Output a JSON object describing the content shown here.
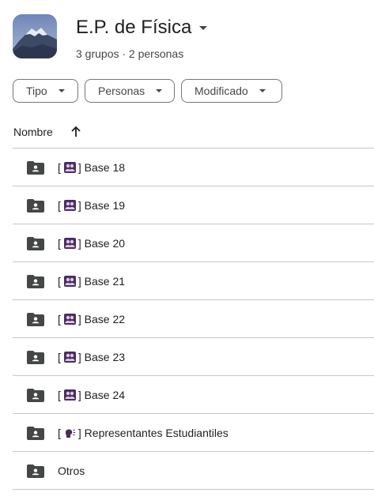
{
  "header": {
    "title": "E.P. de Física",
    "subtitle": "3 grupos · 2 personas",
    "avatar_icon": "mountain-photo"
  },
  "filters": [
    {
      "label": "Tipo"
    },
    {
      "label": "Personas"
    },
    {
      "label": "Modificado"
    }
  ],
  "list_header": {
    "name_label": "Nombre",
    "sort_icon": "arrow-up-icon"
  },
  "items": [
    {
      "prefix": "[",
      "icon": "people-icon",
      "suffix": "] Base 18"
    },
    {
      "prefix": "[",
      "icon": "people-icon",
      "suffix": "] Base 19"
    },
    {
      "prefix": "[",
      "icon": "people-icon",
      "suffix": "] Base 20"
    },
    {
      "prefix": "[",
      "icon": "people-icon",
      "suffix": "] Base 21"
    },
    {
      "prefix": "[",
      "icon": "people-icon",
      "suffix": "] Base 22"
    },
    {
      "prefix": "[",
      "icon": "people-icon",
      "suffix": "] Base 23"
    },
    {
      "prefix": "[",
      "icon": "people-icon",
      "suffix": "] Base 24"
    },
    {
      "prefix": "[",
      "icon": "speaking-head-icon",
      "suffix": "] Representantes Estudiantiles"
    },
    {
      "prefix": "",
      "icon": "",
      "suffix": "Otros"
    }
  ],
  "colors": {
    "folder": "#444746",
    "divider": "#c7c7c7",
    "emoji": "#4a2d5c"
  }
}
